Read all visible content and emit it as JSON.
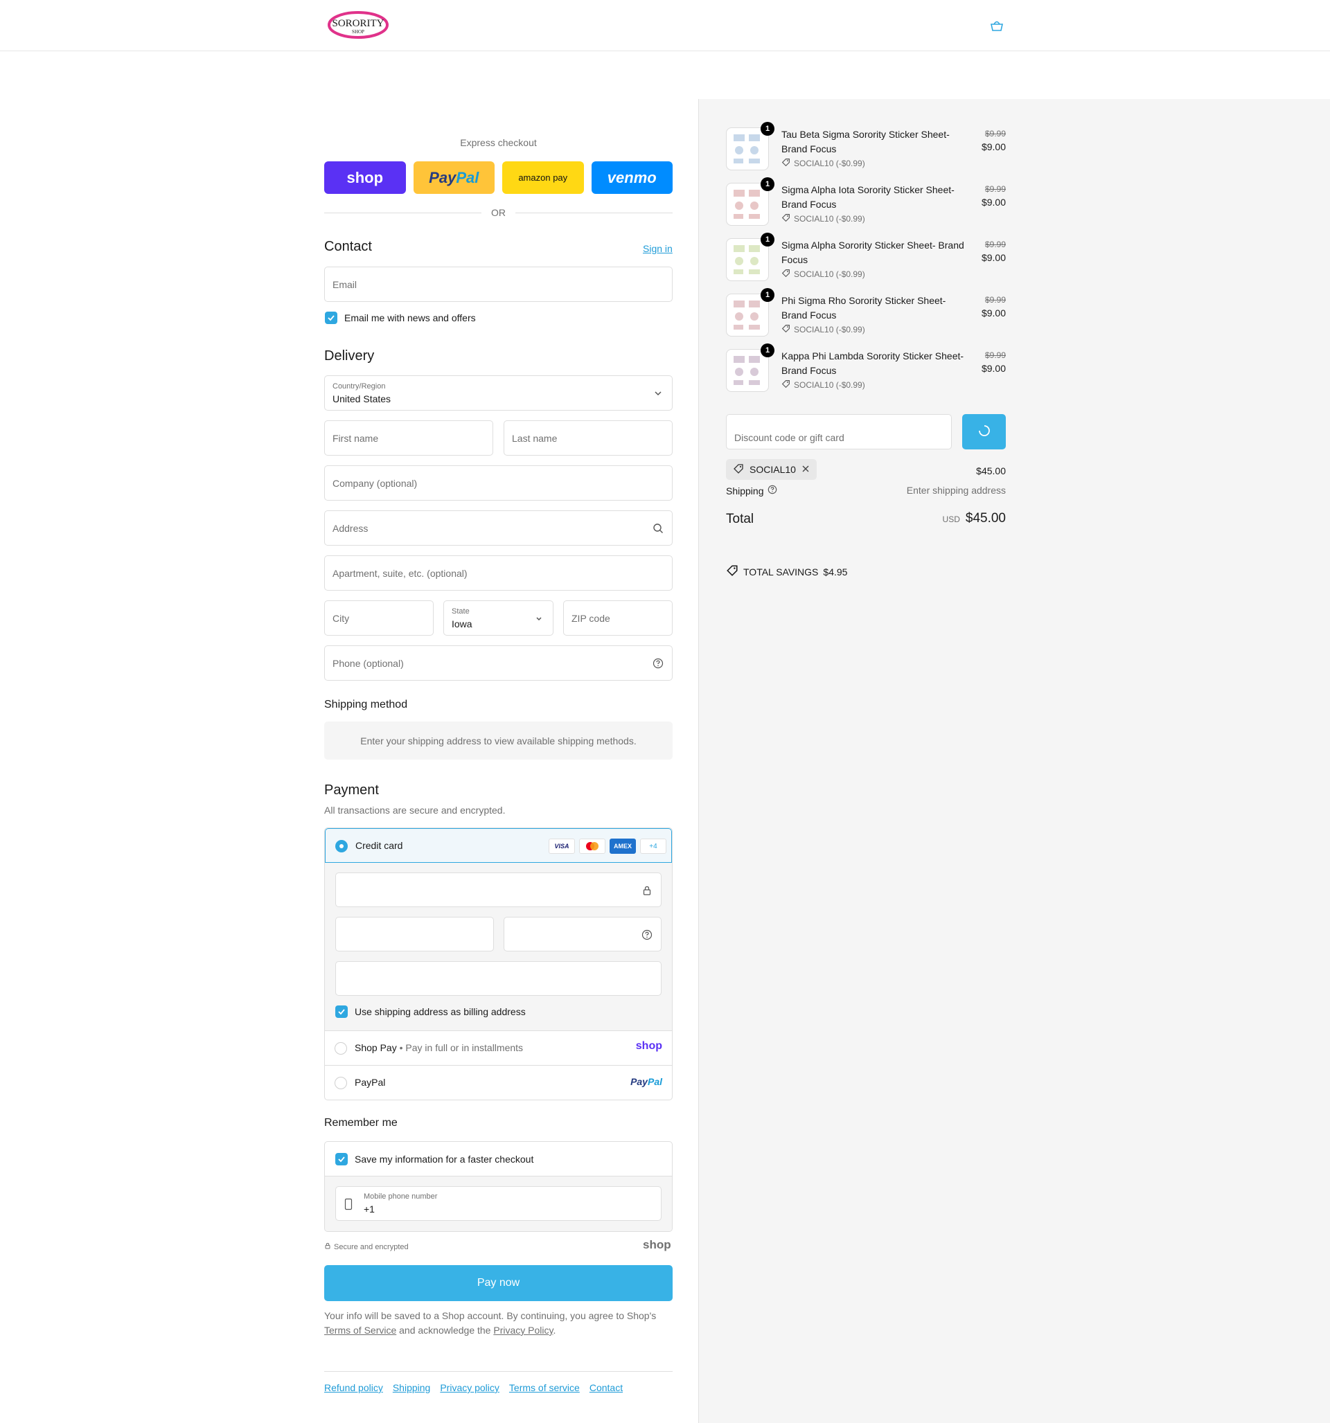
{
  "brand": {
    "logo_text": "SORORITY",
    "logo_subtext": "SHOP"
  },
  "express": {
    "title": "Express checkout",
    "shop": "shop",
    "paypal_a": "Pay",
    "paypal_b": "Pal",
    "amazon": "amazon pay",
    "venmo": "venmo",
    "or": "OR"
  },
  "contact": {
    "title": "Contact",
    "sign_in": "Sign in",
    "email_placeholder": "Email",
    "newsletter_label": "Email me with news and offers"
  },
  "delivery": {
    "title": "Delivery",
    "country_label": "Country/Region",
    "country_value": "United States",
    "first_name": "First name",
    "last_name": "Last name",
    "company": "Company (optional)",
    "address": "Address",
    "apartment": "Apartment, suite, etc. (optional)",
    "city": "City",
    "state_label": "State",
    "state_value": "Iowa",
    "zip": "ZIP code",
    "phone": "Phone (optional)"
  },
  "shipping_method": {
    "title": "Shipping method",
    "message": "Enter your shipping address to view available shipping methods."
  },
  "payment": {
    "title": "Payment",
    "subtitle": "All transactions are secure and encrypted.",
    "credit_card": "Credit card",
    "card_logos": [
      "VISA",
      "",
      "AMEX",
      "+4"
    ],
    "billing_label": "Use shipping address as billing address",
    "shop_pay": "Shop Pay",
    "shop_pay_sub": "Pay in full or in installments",
    "shop_pay_logo": "shop",
    "paypal": "PayPal",
    "paypal_logo_a": "Pay",
    "paypal_logo_b": "Pal"
  },
  "remember": {
    "title": "Remember me",
    "save_label": "Save my information for a faster checkout",
    "phone_label": "Mobile phone number",
    "phone_value": "+1",
    "secure": "Secure and encrypted",
    "shop_logo": "shop"
  },
  "pay_now": "Pay now",
  "fine_print": {
    "part1": "Your info will be saved to a Shop account. By continuing, you agree to Shop's ",
    "terms": "Terms of Service",
    "part2": " and acknowledge the ",
    "privacy": "Privacy Policy",
    "part3": "."
  },
  "footer": [
    "Refund policy",
    "Shipping",
    "Privacy policy",
    "Terms of service",
    "Contact"
  ],
  "cart": {
    "items": [
      {
        "qty": "1",
        "name": "Tau Beta Sigma Sorority Sticker Sheet- Brand Focus",
        "discount": "SOCIAL10 (-$0.99)",
        "original": "$9.99",
        "price": "$9.00"
      },
      {
        "qty": "1",
        "name": "Sigma Alpha Iota Sorority Sticker Sheet- Brand Focus",
        "discount": "SOCIAL10 (-$0.99)",
        "original": "$9.99",
        "price": "$9.00"
      },
      {
        "qty": "1",
        "name": "Sigma Alpha Sorority Sticker Sheet- Brand Focus",
        "discount": "SOCIAL10 (-$0.99)",
        "original": "$9.99",
        "price": "$9.00"
      },
      {
        "qty": "1",
        "name": "Phi Sigma Rho Sorority Sticker Sheet- Brand Focus",
        "discount": "SOCIAL10 (-$0.99)",
        "original": "$9.99",
        "price": "$9.00"
      },
      {
        "qty": "1",
        "name": "Kappa Phi Lambda Sorority Sticker Sheet- Brand Focus",
        "discount": "SOCIAL10 (-$0.99)",
        "original": "$9.99",
        "price": "$9.00"
      }
    ],
    "discount_placeholder": "Discount code or gift card",
    "applied_code": "SOCIAL10",
    "subtotal": "$45.00",
    "shipping_label": "Shipping",
    "shipping_value": "Enter shipping address",
    "total_label": "Total",
    "currency": "USD",
    "total": "$45.00",
    "savings_label": "TOTAL SAVINGS",
    "savings_value": "$4.95"
  },
  "colors": {
    "accent": "#2ea7e0",
    "pay_button": "#38b2e6",
    "shop_purple": "#5a31f4",
    "paypal_yellow": "#ffc439",
    "amazon_yellow": "#ffd814",
    "venmo_blue": "#008cff"
  }
}
